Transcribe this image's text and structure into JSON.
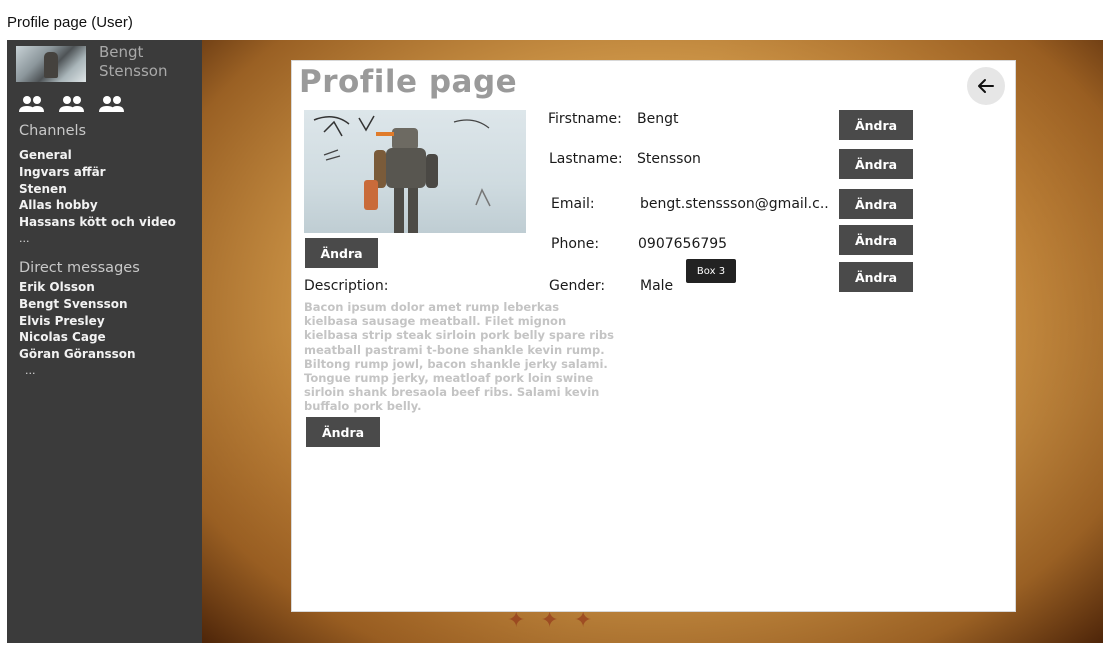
{
  "window": {
    "title": "Profile page (User)"
  },
  "sidebar": {
    "user": {
      "first_name": "Bengt",
      "last_name": "Stensson"
    },
    "channels_title": "Channels",
    "channels": [
      "General",
      "Ingvars affär",
      "Stenen",
      "Allas hobby",
      "Hassans kött och video",
      "..."
    ],
    "dm_title": "Direct messages",
    "direct_messages": [
      "Erik Olsson",
      "Bengt Svensson",
      "Elvis Presley",
      "Nicolas Cage",
      "Göran Göransson",
      "..."
    ]
  },
  "profile": {
    "title": "Profile page",
    "photo_button": "Ändra",
    "fields": {
      "firstname": {
        "label": "Firstname:",
        "value": "Bengt",
        "button": "Ändra"
      },
      "lastname": {
        "label": "Lastname:",
        "value": "Stensson",
        "button": "Ändra"
      },
      "email": {
        "label": "Email:",
        "value": "bengt.stenssson@gmail.c..",
        "button": "Ändra"
      },
      "phone": {
        "label": "Phone:",
        "value": "0907656795",
        "button": "Ändra"
      },
      "gender": {
        "label": "Gender:",
        "value": "Male",
        "button": "Ändra"
      }
    },
    "description": {
      "label": "Description:",
      "text": "Bacon ipsum dolor amet rump leberkas kielbasa sausage meatball. Filet mignon kielbasa strip steak sirloin pork belly spare ribs meatball pastrami t-bone shankle kevin rump. Biltong rump jowl, bacon shankle jerky salami. Tongue rump jerky, meatloaf pork loin swine sirloin shank bresaola beef ribs. Salami kevin buffalo pork belly.",
      "button": "Ändra"
    },
    "tooltip": "Box 3"
  },
  "colors": {
    "sidebar_bg": "#3b3b3b",
    "button_bg": "#4a4a4a",
    "title_gray": "#9a9a9a",
    "parchment": "#d9a454"
  },
  "icons": [
    "user-group-icon",
    "user-group-icon",
    "user-group-icon",
    "arrow-left-icon"
  ]
}
